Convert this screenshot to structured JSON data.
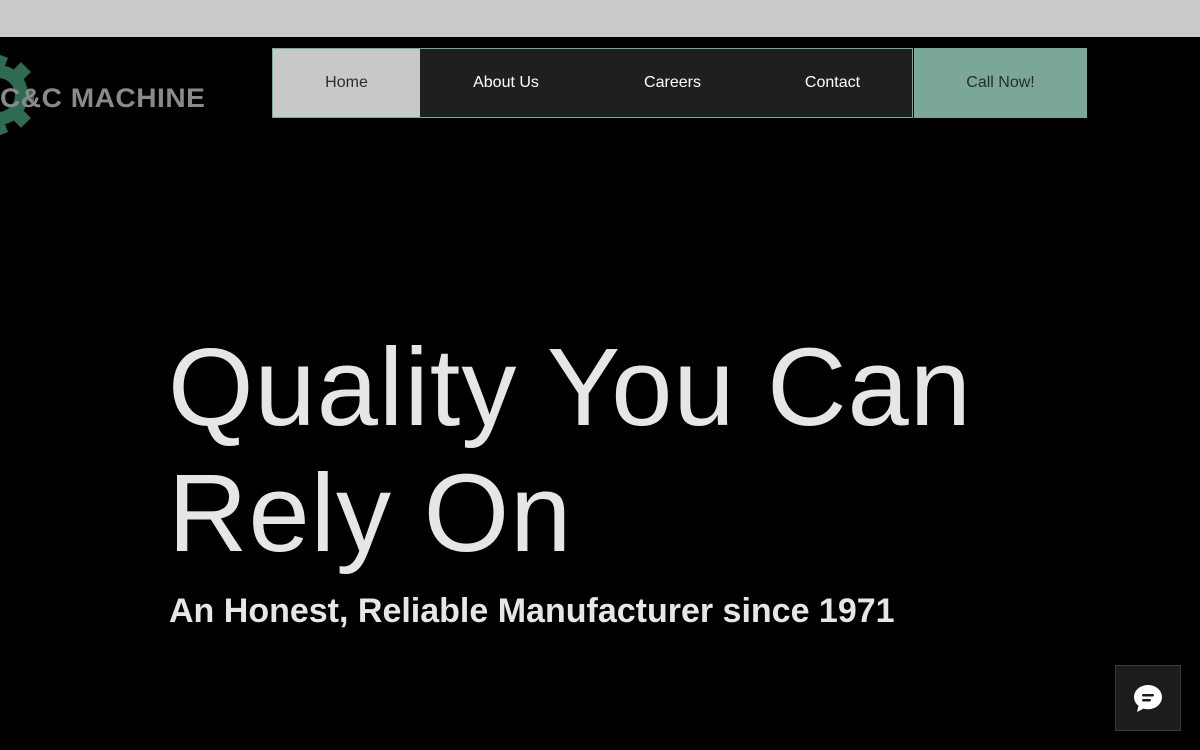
{
  "brand": {
    "logo_text": "C&C MACHINE",
    "logo_icon": "gear-icon",
    "accent_color": "#2f6b52",
    "logo_text_color": "#8a8a8a"
  },
  "nav": {
    "items": [
      {
        "label": "Home",
        "active": true
      },
      {
        "label": "About Us",
        "active": false
      },
      {
        "label": "Careers",
        "active": false
      },
      {
        "label": "Contact",
        "active": false
      }
    ],
    "cta_label": "Call Now!",
    "border_color": "#7aa79a",
    "cta_color": "#7aa79a"
  },
  "hero": {
    "title": "Quality You Can Rely On",
    "subtitle": "An Honest, Reliable Manufacturer since 1971"
  },
  "chat": {
    "icon": "chat-bubble-icon"
  }
}
